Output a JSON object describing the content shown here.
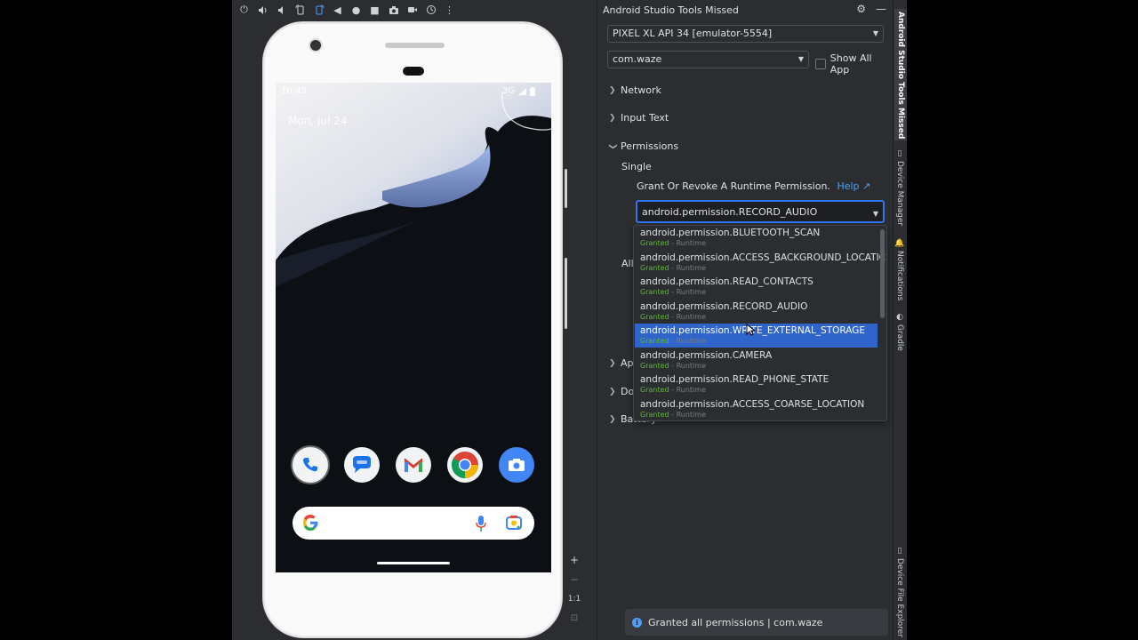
{
  "emulator": {
    "toolbar_icons": [
      "power-icon",
      "volume-up-icon",
      "volume-down-icon",
      "rotate-left-icon",
      "rotate-right-icon",
      "back-icon",
      "home-icon",
      "overview-icon",
      "camera-screenshot-icon",
      "screen-record-icon",
      "snapshot-icon",
      "more-icon"
    ],
    "status_time": "10:43",
    "status_network": "3G",
    "date": "Mon, Jul 24",
    "dock_apps": [
      "phone-app-icon",
      "messages-app-icon",
      "gmail-app-icon",
      "chrome-app-icon",
      "camera-app-icon"
    ],
    "zoom": {
      "in": "+",
      "out": "−",
      "actual": "1:1"
    }
  },
  "tool_window": {
    "title": "Android Studio Tools Missed",
    "device_combo": "PIXEL XL API 34 [emulator-5554]",
    "app_combo": "com.waze",
    "show_all_label": "Show All App",
    "show_all_checked": false,
    "sections": {
      "network": "Network",
      "input_text": "Input Text",
      "permissions": "Permissions",
      "single": "Single",
      "all": "All",
      "apk": "Apk",
      "doze": "Doz",
      "battery": "Battery"
    },
    "grant_description": "Grant Or Revoke A Runtime Permission.",
    "help_label": "Help ↗",
    "selected_permission": "android.permission.RECORD_AUDIO",
    "permission_options": [
      {
        "name": "android.permission.BLUETOOTH_SCAN",
        "status": "Granted",
        "type": " - Runtime"
      },
      {
        "name": "android.permission.ACCESS_BACKGROUND_LOCATIC",
        "status": "Granted",
        "type": " - Runtime"
      },
      {
        "name": "android.permission.READ_CONTACTS",
        "status": "Granted",
        "type": " - Runtime"
      },
      {
        "name": "android.permission.RECORD_AUDIO",
        "status": "Granted",
        "type": " - Runtime"
      },
      {
        "name": "android.permission.WRITE_EXTERNAL_STORAGE",
        "status": "Granted",
        "type": " - Runtime"
      },
      {
        "name": "android.permission.CAMERA",
        "status": "Granted",
        "type": " - Runtime"
      },
      {
        "name": "android.permission.READ_PHONE_STATE",
        "status": "Granted",
        "type": " - Runtime"
      },
      {
        "name": "android.permission.ACCESS_COARSE_LOCATION",
        "status": "Granted",
        "type": " - Runtime"
      }
    ],
    "highlighted_index": 4,
    "toast": "Granted all permissions | com.waze"
  },
  "side_stripe": {
    "active": "Android Studio Tools Missed",
    "device_manager": "Device Manager",
    "notifications": "Notifications",
    "gradle": "Gradle",
    "device_file_explorer": "Device File Explorer"
  },
  "colors": {
    "ide_background": "#2b2d30",
    "selection": "#2f65ca",
    "focus": "#3574f0",
    "granted": "#5fb832",
    "link": "#4aa1ff"
  }
}
